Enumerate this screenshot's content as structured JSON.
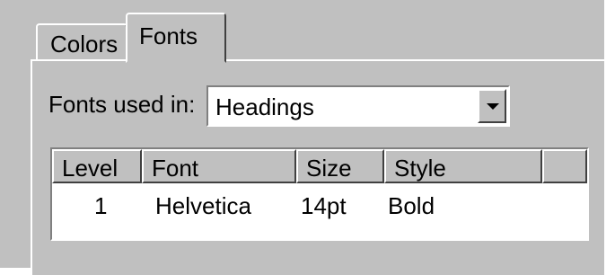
{
  "tabs": [
    {
      "label": "Colors",
      "selected": false
    },
    {
      "label": "Fonts",
      "selected": true
    }
  ],
  "fonts_used_in": {
    "label": "Fonts used in:",
    "value": "Headings"
  },
  "table": {
    "columns": [
      "Level",
      "Font",
      "Size",
      "Style",
      ""
    ],
    "rows": [
      {
        "level": "1",
        "font": "Helvetica",
        "size": "14pt",
        "style": "Bold"
      }
    ]
  },
  "colors": {
    "face": "#c0c0c0",
    "highlight": "#ffffff",
    "shadow": "#808080",
    "dark_shadow": "#404040"
  },
  "icons": {
    "combo_button": "chevron-down-icon"
  }
}
